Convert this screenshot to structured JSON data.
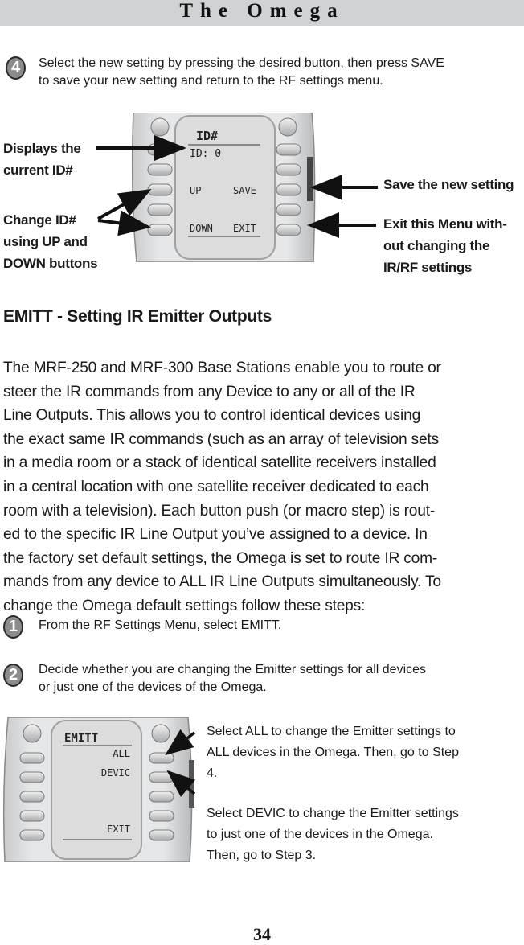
{
  "header": {
    "title": "The Omega"
  },
  "step4": {
    "number": "4",
    "lines": [
      "Select the new setting by pressing the desired button, then press SAVE",
      "to save your new setting and return to the RF settings menu."
    ]
  },
  "figure1": {
    "screen": {
      "title": "ID#",
      "value": "ID: 0",
      "left_up": "UP",
      "right_save": "SAVE",
      "left_down": "DOWN",
      "right_exit": "EXIT"
    },
    "callouts": {
      "displays": [
        "Displays the",
        "current ID#"
      ],
      "change": [
        "Change ID#",
        "using UP and",
        "DOWN buttons"
      ],
      "save": [
        "Save the new setting"
      ],
      "exit": [
        "Exit this Menu with-",
        "out changing the",
        "IR/RF settings"
      ]
    }
  },
  "section": {
    "heading": "EMITT - Setting IR Emitter Outputs",
    "paragraph_lines": [
      "The MRF-250 and MRF-300 Base Stations enable you to route or",
      "steer the IR commands from any Device to any or all of the IR",
      "Line Outputs. This allows you to control identical devices using",
      "the exact same IR commands (such as an array of television sets",
      "in a media room or a stack of identical satellite receivers installed",
      "in a central location with one satellite receiver dedicated to each",
      "room with a television). Each button push (or macro step) is rout-",
      "ed to the specific IR Line Output you’ve assigned to a device. In",
      "the factory set default settings, the Omega is set to route IR com-",
      "mands from any device to ALL IR Line Outputs simultaneously. To",
      "change the Omega default settings follow these steps:"
    ]
  },
  "step1": {
    "number": "1",
    "lines": [
      "From the RF Settings Menu, select EMITT."
    ]
  },
  "step2": {
    "number": "2",
    "lines": [
      "Decide whether you are changing the Emitter settings for all devices",
      "or just one of the devices of the Omega."
    ]
  },
  "figure2": {
    "screen": {
      "title": "EMITT",
      "opt_all": "ALL",
      "opt_devic": "DEVIC",
      "opt_exit": "EXIT"
    },
    "note_all": [
      "Select ALL to change the Emitter settings to",
      "ALL devices in the Omega. Then, go to Step",
      "4."
    ],
    "note_devic": [
      "Select DEVIC to change the Emitter settings",
      "to just one of the devices in the Omega.",
      "Then, go to Step 3."
    ]
  },
  "footer": {
    "page_number": "34"
  }
}
